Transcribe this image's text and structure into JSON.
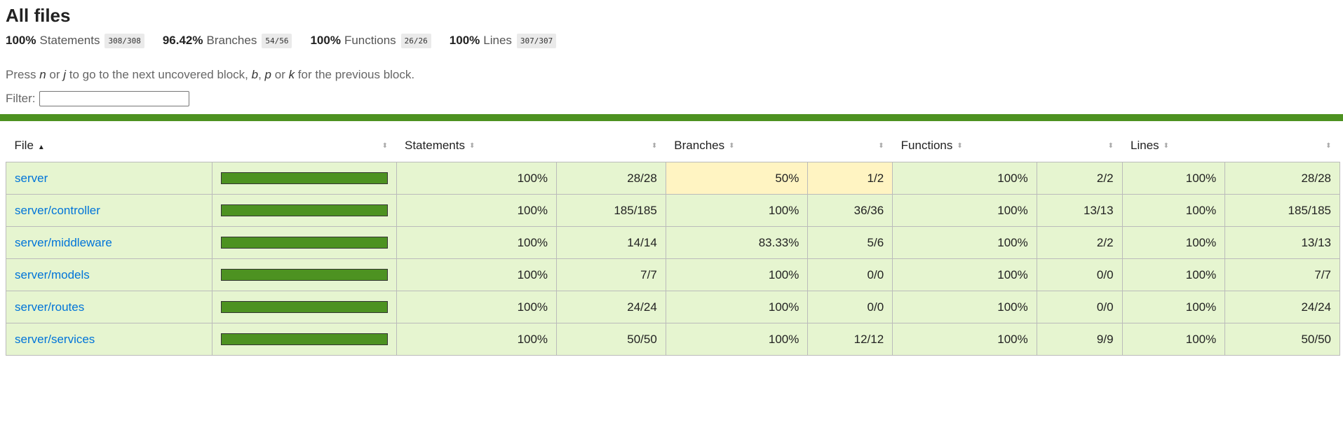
{
  "page": {
    "title": "All files"
  },
  "summary": [
    {
      "pct": "100%",
      "label": "Statements",
      "frac": "308/308"
    },
    {
      "pct": "96.42%",
      "label": "Branches",
      "frac": "54/56"
    },
    {
      "pct": "100%",
      "label": "Functions",
      "frac": "26/26"
    },
    {
      "pct": "100%",
      "label": "Lines",
      "frac": "307/307"
    }
  ],
  "hint": {
    "p1": "Press ",
    "k1": "n",
    "p2": " or ",
    "k2": "j",
    "p3": " to go to the next uncovered block, ",
    "k3": "b",
    "p4": ", ",
    "k4": "p",
    "p5": " or ",
    "k5": "k",
    "p6": " for the previous block."
  },
  "filter": {
    "label": "Filter:",
    "value": ""
  },
  "colors": {
    "status_high": "#4d9221",
    "row_high": "#e6f5d0",
    "row_medium": "#fff4c2",
    "link": "#0074d9"
  },
  "table": {
    "headers": {
      "file": "File",
      "statements": "Statements",
      "branches": "Branches",
      "functions": "Functions",
      "lines": "Lines"
    },
    "rows": [
      {
        "file": "server",
        "coverage": 1.0,
        "stmt_pct": "100%",
        "stmt_frac": "28/28",
        "br_pct": "50%",
        "br_frac": "1/2",
        "fn_pct": "100%",
        "fn_frac": "2/2",
        "ln_pct": "100%",
        "ln_frac": "28/28"
      },
      {
        "file": "server/controller",
        "coverage": 1.0,
        "stmt_pct": "100%",
        "stmt_frac": "185/185",
        "br_pct": "100%",
        "br_frac": "36/36",
        "fn_pct": "100%",
        "fn_frac": "13/13",
        "ln_pct": "100%",
        "ln_frac": "185/185"
      },
      {
        "file": "server/middleware",
        "coverage": 1.0,
        "stmt_pct": "100%",
        "stmt_frac": "14/14",
        "br_pct": "83.33%",
        "br_frac": "5/6",
        "fn_pct": "100%",
        "fn_frac": "2/2",
        "ln_pct": "100%",
        "ln_frac": "13/13"
      },
      {
        "file": "server/models",
        "coverage": 1.0,
        "stmt_pct": "100%",
        "stmt_frac": "7/7",
        "br_pct": "100%",
        "br_frac": "0/0",
        "fn_pct": "100%",
        "fn_frac": "0/0",
        "ln_pct": "100%",
        "ln_frac": "7/7"
      },
      {
        "file": "server/routes",
        "coverage": 1.0,
        "stmt_pct": "100%",
        "stmt_frac": "24/24",
        "br_pct": "100%",
        "br_frac": "0/0",
        "fn_pct": "100%",
        "fn_frac": "0/0",
        "ln_pct": "100%",
        "ln_frac": "24/24"
      },
      {
        "file": "server/services",
        "coverage": 1.0,
        "stmt_pct": "100%",
        "stmt_frac": "50/50",
        "br_pct": "100%",
        "br_frac": "12/12",
        "fn_pct": "100%",
        "fn_frac": "9/9",
        "ln_pct": "100%",
        "ln_frac": "50/50"
      }
    ]
  }
}
